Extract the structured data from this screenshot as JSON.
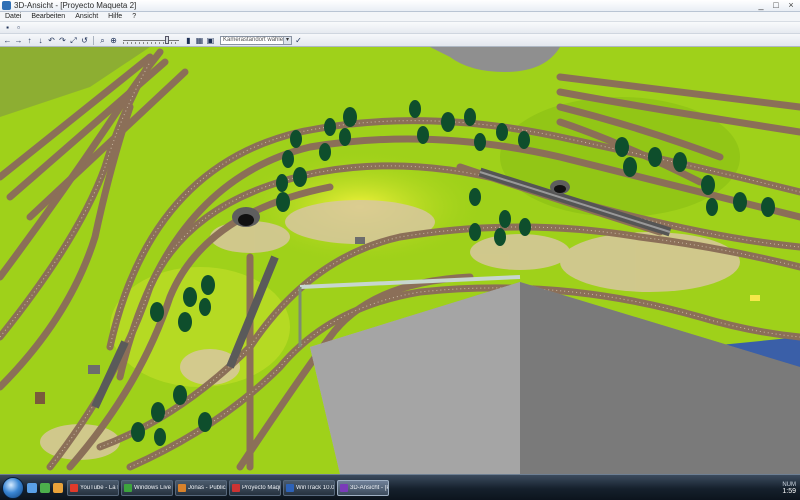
{
  "window": {
    "title": "3D-Ansicht - [Proyecto Maqueta 2]",
    "minimize": "_",
    "maximize": "□",
    "close": "×"
  },
  "menu": [
    "Datei",
    "Bearbeiten",
    "Ansicht",
    "Hilfe",
    "?"
  ],
  "toolbar": {
    "slider_level": 0.8,
    "dropdown_value": "Kamerastandort wählen"
  },
  "icons": {
    "save": "▪",
    "print": "▫",
    "move_left": "←",
    "move_right": "→",
    "move_up": "↑",
    "move_down": "↓",
    "rotate_left": "↶",
    "rotate_right": "↷",
    "tilt": "⤢",
    "reset": "↺",
    "zoom": "⌕",
    "zoom_fit": "⊕",
    "train": "▮",
    "grid": "▦",
    "camera": "▣",
    "check": "✓"
  },
  "taskbar": {
    "items": [
      {
        "label": "YouTube - La Pasión...",
        "color": "#e03a2b"
      },
      {
        "label": "Windows Live Messe...",
        "color": "#3da43d"
      },
      {
        "label": "Jonas - Publicar respu...",
        "color": "#d9822b"
      },
      {
        "label": "Proyecto Maqueta 2...",
        "color": "#c33"
      },
      {
        "label": "WinTrack 10.0 - [Pro...",
        "color": "#2d62b8"
      },
      {
        "label": "3D-Ansicht - [Proye...",
        "color": "#7a3bb8",
        "active": true
      }
    ],
    "tray_status": "NUM",
    "clock": "1:59"
  },
  "colors": {
    "terrain": "#9fd11a",
    "track": "#8b6f58",
    "tree": "#0e4e2c",
    "table_edge": "#9a9a9a",
    "water": "#3a5fa8",
    "background": "#2b2b2b"
  }
}
